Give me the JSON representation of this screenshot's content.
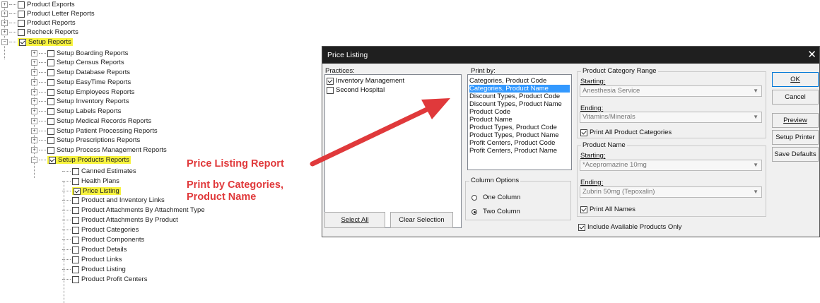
{
  "tree": {
    "items": [
      {
        "label": "Product Exports",
        "expander": "+",
        "checked": false,
        "highlight": false
      },
      {
        "label": "Product Letter Reports",
        "expander": "+",
        "checked": false,
        "highlight": false
      },
      {
        "label": "Product Reports",
        "expander": "+",
        "checked": false,
        "highlight": false
      },
      {
        "label": "Recheck Reports",
        "expander": "+",
        "checked": false,
        "highlight": false
      },
      {
        "label": "Setup Reports",
        "expander": "−",
        "checked": true,
        "highlight": true
      },
      {
        "label": "Setup Boarding Reports",
        "expander": "+",
        "checked": false,
        "highlight": false
      },
      {
        "label": "Setup Census Reports",
        "expander": "+",
        "checked": false,
        "highlight": false
      },
      {
        "label": "Setup Database Reports",
        "expander": "+",
        "checked": false,
        "highlight": false
      },
      {
        "label": "Setup EasyTime Reports",
        "expander": "+",
        "checked": false,
        "highlight": false
      },
      {
        "label": "Setup Employees Reports",
        "expander": "+",
        "checked": false,
        "highlight": false
      },
      {
        "label": "Setup Inventory Reports",
        "expander": "+",
        "checked": false,
        "highlight": false
      },
      {
        "label": "Setup Labels Reports",
        "expander": "+",
        "checked": false,
        "highlight": false
      },
      {
        "label": "Setup Medical Records Reports",
        "expander": "+",
        "checked": false,
        "highlight": false
      },
      {
        "label": "Setup Patient Processing Reports",
        "expander": "+",
        "checked": false,
        "highlight": false
      },
      {
        "label": "Setup Prescriptions Reports",
        "expander": "+",
        "checked": false,
        "highlight": false
      },
      {
        "label": "Setup Process Management Reports",
        "expander": "+",
        "checked": false,
        "highlight": false
      },
      {
        "label": "Setup Products Reports",
        "expander": "−",
        "checked": true,
        "highlight": true
      },
      {
        "label": "Canned Estimates",
        "expander": "",
        "checked": false,
        "highlight": false
      },
      {
        "label": "Health Plans",
        "expander": "",
        "checked": false,
        "highlight": false
      },
      {
        "label": "Price Listing",
        "expander": "",
        "checked": true,
        "highlight": true
      },
      {
        "label": "Product and Inventory Links",
        "expander": "",
        "checked": false,
        "highlight": false
      },
      {
        "label": "Product Attachments By Attachment Type",
        "expander": "",
        "checked": false,
        "highlight": false
      },
      {
        "label": "Product Attachments By Product",
        "expander": "",
        "checked": false,
        "highlight": false
      },
      {
        "label": "Product Categories",
        "expander": "",
        "checked": false,
        "highlight": false
      },
      {
        "label": "Product Components",
        "expander": "",
        "checked": false,
        "highlight": false
      },
      {
        "label": "Product Details",
        "expander": "",
        "checked": false,
        "highlight": false
      },
      {
        "label": "Product Links",
        "expander": "",
        "checked": false,
        "highlight": false
      },
      {
        "label": "Product Listing",
        "expander": "",
        "checked": false,
        "highlight": false
      },
      {
        "label": "Product Profit Centers",
        "expander": "",
        "checked": false,
        "highlight": false
      }
    ]
  },
  "annotations": {
    "line1": "Price Listing Report",
    "line2a": "Print by Categories,",
    "line2b": "Product Name"
  },
  "dialog": {
    "title": "Price Listing",
    "practices_label": "Practices:",
    "practices": [
      {
        "label": "Inventory Management",
        "checked": true
      },
      {
        "label": "Second Hospital",
        "checked": false
      }
    ],
    "select_all": "Select All",
    "clear_selection": "Clear Selection",
    "print_by_label": "Print by:",
    "print_by_options": [
      "Categories, Product Code",
      "Categories, Product Name",
      "Discount Types, Product Code",
      "Discount Types, Product Name",
      "Product Code",
      "Product Name",
      "Product Types, Product Code",
      "Product Types, Product Name",
      "Profit Centers, Product Code",
      "Profit Centers, Product Name"
    ],
    "print_by_selected": "Categories, Product Name",
    "column_options_label": "Column Options",
    "one_column": "One Column",
    "two_column": "Two Column",
    "column_selected": "Two Column",
    "category_range_label": "Product Category Range",
    "starting_label": "Starting:",
    "category_starting": "Anesthesia Service",
    "ending_label": "Ending:",
    "category_ending": "Vitamins/Minerals",
    "print_all_categories": "Print All Product Categories",
    "print_all_categories_checked": true,
    "product_name_label": "Product Name",
    "name_starting": "*Acepromazine 10mg",
    "name_ending": "Zubrin 50mg (Tepoxalin)",
    "print_all_names": "Print All Names",
    "print_all_names_checked": true,
    "include_available": "Include Available Products Only",
    "include_available_checked": true,
    "ok": "OK",
    "cancel": "Cancel",
    "preview": "Preview",
    "setup_printer": "Setup Printer",
    "save_defaults": "Save Defaults"
  },
  "colors": {
    "accent_red": "#e0393b",
    "highlight_yellow": "#f7f33e",
    "selection_blue": "#3399ff",
    "titlebar": "#1f1f1f"
  }
}
